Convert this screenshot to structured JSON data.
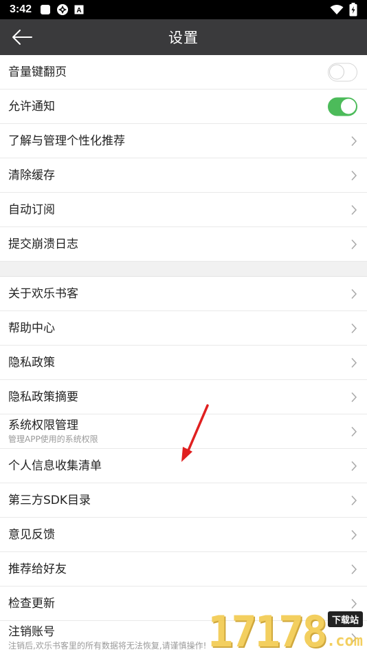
{
  "status_bar": {
    "time": "3:42",
    "icons_left": [
      "white-square-icon",
      "settings-flower-icon",
      "a-badge-icon"
    ],
    "icons_right": [
      "wifi-icon",
      "battery-charging-icon"
    ]
  },
  "nav": {
    "title": "设置",
    "back_icon": "arrow-left-icon"
  },
  "section1": [
    {
      "label": "音量键翻页",
      "control": "toggle",
      "on": false
    },
    {
      "label": "允许通知",
      "control": "toggle",
      "on": true
    },
    {
      "label": "了解与管理个性化推荐",
      "control": "chevron"
    },
    {
      "label": "清除缓存",
      "control": "chevron"
    },
    {
      "label": "自动订阅",
      "control": "chevron"
    },
    {
      "label": "提交崩溃日志",
      "control": "chevron"
    }
  ],
  "section2": [
    {
      "label": "关于欢乐书客"
    },
    {
      "label": "帮助中心"
    },
    {
      "label": "隐私政策"
    },
    {
      "label": "隐私政策摘要"
    },
    {
      "label": "系统权限管理",
      "sub": "管理APP使用的系统权限"
    },
    {
      "label": "个人信息收集清单"
    },
    {
      "label": "第三方SDK目录"
    },
    {
      "label": "意见反馈"
    },
    {
      "label": "推荐给好友"
    },
    {
      "label": "检查更新"
    },
    {
      "label": "注销账号",
      "sub": "注销后,欢乐书客里的所有数据将无法恢复,请谨慎操作!"
    }
  ],
  "colors": {
    "nav_bg": "#3a3a3c",
    "toggle_on": "#4cbb5a",
    "annotation_arrow": "#e02020"
  },
  "watermark": {
    "digits": "17178",
    "badge": "下载站",
    "suffix": ".com"
  }
}
